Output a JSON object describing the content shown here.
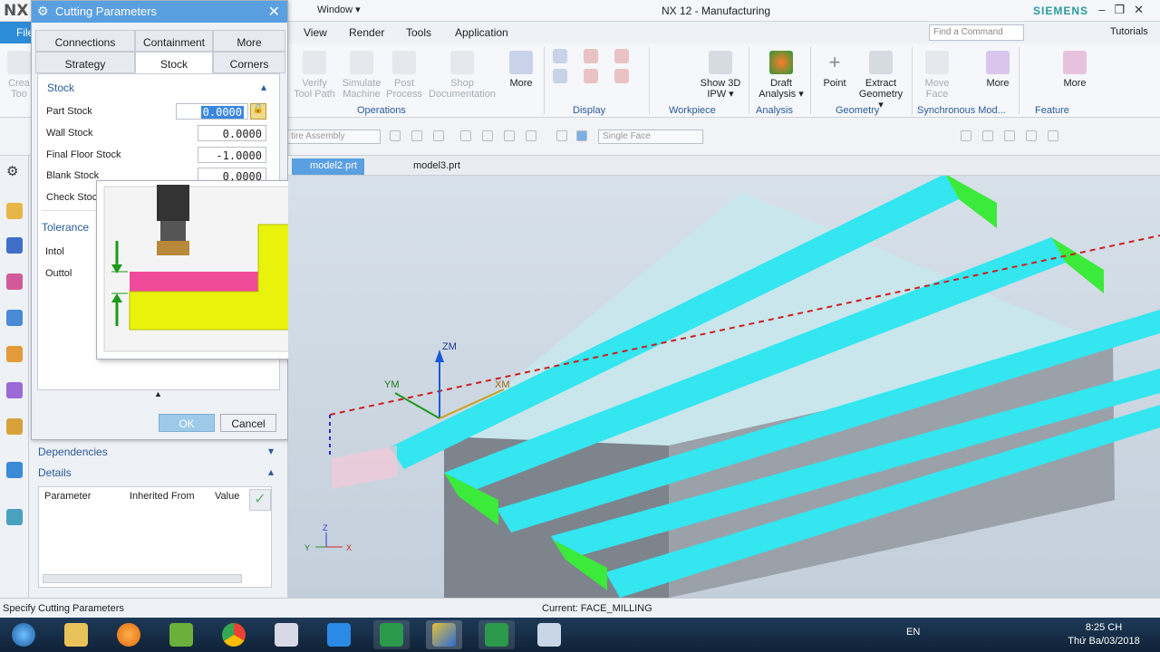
{
  "titlebar": {
    "logo": "NX",
    "window_menu": "Window ▾",
    "title": "NX 12 - Manufacturing",
    "brand": "SIEMENS"
  },
  "menubar": {
    "file": "File",
    "tabs": [
      "View",
      "Render",
      "Tools",
      "Application"
    ],
    "search_placeholder": "Find a Command",
    "tutorials": "Tutorials"
  },
  "ribbon": {
    "buttons": {
      "create_tool": "Crea Too",
      "verify": "Verify Tool Path",
      "simulate": "Simulate Machine",
      "post": "Post Process",
      "shop": "Shop Documentation",
      "more1": "More",
      "show3d": "Show 3D IPW ▾",
      "draft": "Draft Analysis ▾",
      "point": "Point",
      "extract": "Extract Geometry ▾",
      "move_face": "Move Face",
      "more2": "More",
      "more3": "More"
    },
    "groups": {
      "operations": "Operations",
      "display": "Display",
      "workpiece": "Workpiece",
      "analysis": "Analysis",
      "geometry": "Geometry",
      "synchronous": "Synchronous Mod...",
      "feature": "Feature"
    }
  },
  "selbar": {
    "assembly": "tire Assembly",
    "face_filter": "Single Face"
  },
  "doc_tabs": [
    "model2.prt",
    "model3.prt"
  ],
  "dialog": {
    "title": "Cutting Parameters",
    "tabs_row1": [
      "Connections",
      "Containment",
      "More"
    ],
    "tabs_row2": [
      "Strategy",
      "Stock",
      "Corners"
    ],
    "stock_section": "Stock",
    "fields": [
      {
        "label": "Part Stock",
        "value": "0.0000"
      },
      {
        "label": "Wall Stock",
        "value": "0.0000"
      },
      {
        "label": "Final Floor Stock",
        "value": "-1.0000"
      },
      {
        "label": "Blank Stock",
        "value": "0.0000"
      },
      {
        "label": "Check Stock",
        "value": ""
      }
    ],
    "tolerance_section": "Tolerance",
    "intol": "Intol",
    "outtol": "Outtol",
    "ok": "OK",
    "cancel": "Cancel"
  },
  "panels": {
    "dependencies": "Dependencies",
    "details": "Details",
    "columns": [
      "Parameter",
      "Inherited From",
      "Value"
    ]
  },
  "gfx_labels": {
    "zm": "ZM",
    "ym": "YM",
    "xm": "XM",
    "z": "Z",
    "y": "Y",
    "x": "X"
  },
  "statusbar": {
    "prompt": "Specify Cutting Parameters",
    "current": "Current: FACE_MILLING"
  },
  "taskbar": {
    "lang": "EN",
    "time": "8:25 CH",
    "date": "Thứ Ba/03/2018"
  },
  "colors": {
    "accent": "#5a9fe0",
    "cyan_wall": "#33e6f0",
    "green_end": "#3bea3b",
    "floor": "#c9e6ec",
    "part_side": "#8a8f96",
    "toolpath": "#cc1f1f"
  }
}
